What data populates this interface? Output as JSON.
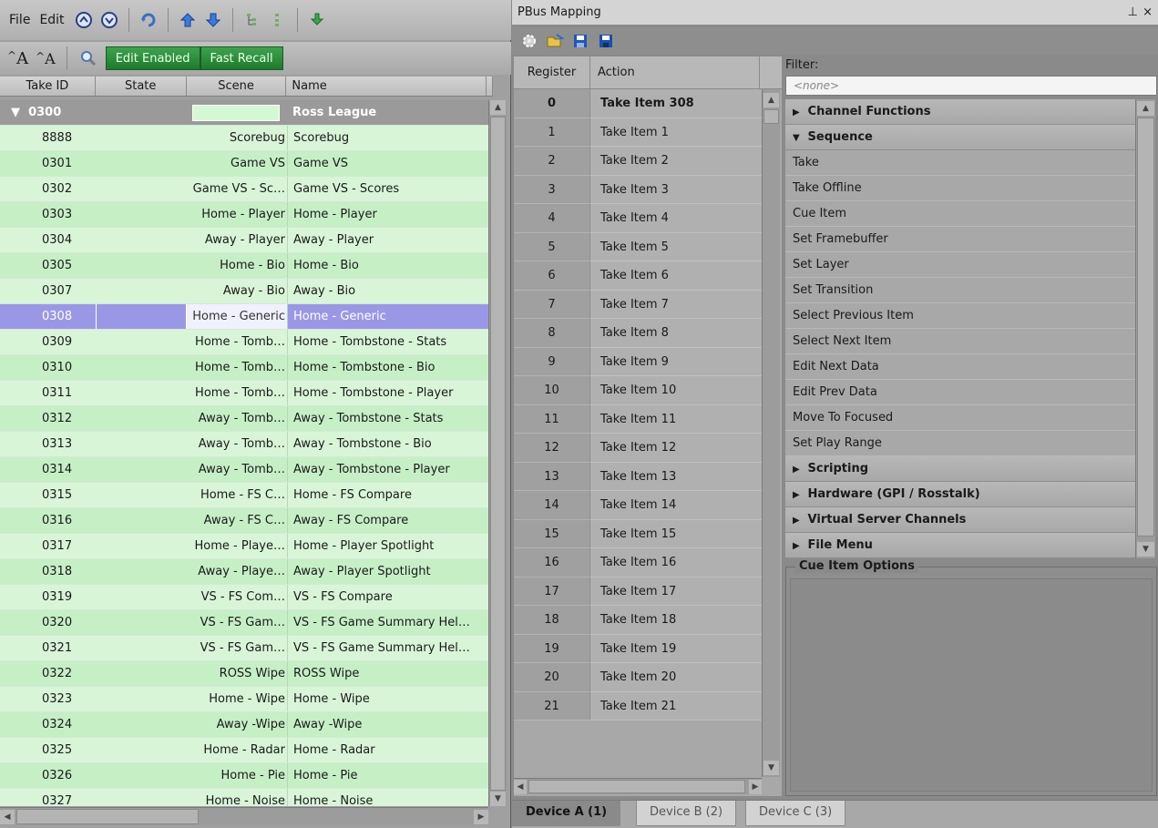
{
  "left": {
    "menu": [
      "File",
      "Edit"
    ],
    "buttons": {
      "edit_enabled": "Edit Enabled",
      "fast_recall": "Fast Recall"
    },
    "columns": [
      "Take ID",
      "State",
      "Scene",
      "Name"
    ],
    "group": {
      "id": "0300",
      "name": "Ross League"
    },
    "rows": [
      {
        "id": "8888",
        "scene": "Scorebug",
        "name": "Scorebug"
      },
      {
        "id": "0301",
        "scene": "Game VS",
        "name": "Game VS"
      },
      {
        "id": "0302",
        "scene": "Game VS - Sc…",
        "name": "Game VS - Scores"
      },
      {
        "id": "0303",
        "scene": "Home - Player",
        "name": "Home - Player"
      },
      {
        "id": "0304",
        "scene": "Away - Player",
        "name": "Away - Player"
      },
      {
        "id": "0305",
        "scene": "Home - Bio",
        "name": "Home - Bio"
      },
      {
        "id": "0307",
        "scene": "Away - Bio",
        "name": "Away - Bio"
      },
      {
        "id": "0308",
        "scene": "Home - Generic",
        "name": "Home - Generic"
      },
      {
        "id": "0309",
        "scene": "Home - Tomb…",
        "name": "Home - Tombstone - Stats"
      },
      {
        "id": "0310",
        "scene": "Home - Tomb…",
        "name": "Home - Tombstone - Bio"
      },
      {
        "id": "0311",
        "scene": "Home - Tomb…",
        "name": "Home - Tombstone - Player"
      },
      {
        "id": "0312",
        "scene": "Away - Tomb…",
        "name": "Away - Tombstone - Stats"
      },
      {
        "id": "0313",
        "scene": "Away - Tomb…",
        "name": "Away - Tombstone - Bio"
      },
      {
        "id": "0314",
        "scene": "Away - Tomb…",
        "name": "Away - Tombstone - Player"
      },
      {
        "id": "0315",
        "scene": "Home - FS C…",
        "name": "Home - FS Compare"
      },
      {
        "id": "0316",
        "scene": "Away - FS C…",
        "name": "Away - FS Compare"
      },
      {
        "id": "0317",
        "scene": "Home - Playe…",
        "name": "Home - Player Spotlight"
      },
      {
        "id": "0318",
        "scene": "Away - Playe…",
        "name": "Away - Player Spotlight"
      },
      {
        "id": "0319",
        "scene": "VS - FS Com…",
        "name": "VS - FS Compare"
      },
      {
        "id": "0320",
        "scene": "VS - FS Gam…",
        "name": "VS - FS Game Summary Hel…"
      },
      {
        "id": "0321",
        "scene": "VS - FS Gam…",
        "name": "VS - FS Game Summary Hel…"
      },
      {
        "id": "0322",
        "scene": "ROSS Wipe",
        "name": "ROSS Wipe"
      },
      {
        "id": "0323",
        "scene": "Home - Wipe",
        "name": "Home - Wipe"
      },
      {
        "id": "0324",
        "scene": "Away -Wipe",
        "name": "Away -Wipe"
      },
      {
        "id": "0325",
        "scene": "Home - Radar",
        "name": "Home - Radar"
      },
      {
        "id": "0326",
        "scene": "Home - Pie",
        "name": "Home - Pie"
      },
      {
        "id": "0327",
        "scene": "Home - Noise",
        "name": "Home - Noise"
      }
    ],
    "selected_id": "0308"
  },
  "right": {
    "title": "PBus Mapping",
    "pin": "2",
    "close": "×",
    "columns": [
      "Register",
      "Action"
    ],
    "registers": [
      {
        "reg": "0",
        "action": "Take Item 308"
      },
      {
        "reg": "1",
        "action": "Take Item 1"
      },
      {
        "reg": "2",
        "action": "Take Item 2"
      },
      {
        "reg": "3",
        "action": "Take Item 3"
      },
      {
        "reg": "4",
        "action": "Take Item 4"
      },
      {
        "reg": "5",
        "action": "Take Item 5"
      },
      {
        "reg": "6",
        "action": "Take Item 6"
      },
      {
        "reg": "7",
        "action": "Take Item 7"
      },
      {
        "reg": "8",
        "action": "Take Item 8"
      },
      {
        "reg": "9",
        "action": "Take Item 9"
      },
      {
        "reg": "10",
        "action": "Take Item 10"
      },
      {
        "reg": "11",
        "action": "Take Item 11"
      },
      {
        "reg": "12",
        "action": "Take Item 12"
      },
      {
        "reg": "13",
        "action": "Take Item 13"
      },
      {
        "reg": "14",
        "action": "Take Item 14"
      },
      {
        "reg": "15",
        "action": "Take Item 15"
      },
      {
        "reg": "16",
        "action": "Take Item 16"
      },
      {
        "reg": "17",
        "action": "Take Item 17"
      },
      {
        "reg": "18",
        "action": "Take Item 18"
      },
      {
        "reg": "19",
        "action": "Take Item 19"
      },
      {
        "reg": "20",
        "action": "Take Item 20"
      },
      {
        "reg": "21",
        "action": "Take Item 21"
      }
    ],
    "filter_label": "Filter:",
    "filter_placeholder": "<none>",
    "actions": [
      {
        "label": "Channel Functions",
        "cat": true,
        "open": false
      },
      {
        "label": "Sequence",
        "cat": true,
        "open": true
      },
      {
        "label": "Take",
        "cat": false
      },
      {
        "label": "Take Offline",
        "cat": false
      },
      {
        "label": "Cue Item",
        "cat": false
      },
      {
        "label": "Set Framebuffer",
        "cat": false
      },
      {
        "label": "Set Layer",
        "cat": false
      },
      {
        "label": "Set Transition",
        "cat": false
      },
      {
        "label": "Select Previous Item",
        "cat": false
      },
      {
        "label": "Select Next Item",
        "cat": false
      },
      {
        "label": "Edit Next Data",
        "cat": false
      },
      {
        "label": "Edit Prev Data",
        "cat": false
      },
      {
        "label": "Move To Focused",
        "cat": false
      },
      {
        "label": "Set Play Range",
        "cat": false
      },
      {
        "label": "Scripting",
        "cat": true,
        "open": false
      },
      {
        "label": "Hardware (GPI / Rosstalk)",
        "cat": true,
        "open": false
      },
      {
        "label": "Virtual Server Channels",
        "cat": true,
        "open": false
      },
      {
        "label": "File Menu",
        "cat": true,
        "open": false
      }
    ],
    "cue_options_title": "Cue Item Options",
    "tabs": [
      "Device A (1)",
      "Device B (2)",
      "Device C (3)"
    ]
  },
  "colors": {
    "row_green": "#c6efc6",
    "selected": "#9a98e6",
    "button_green": "#2e8b3d"
  }
}
